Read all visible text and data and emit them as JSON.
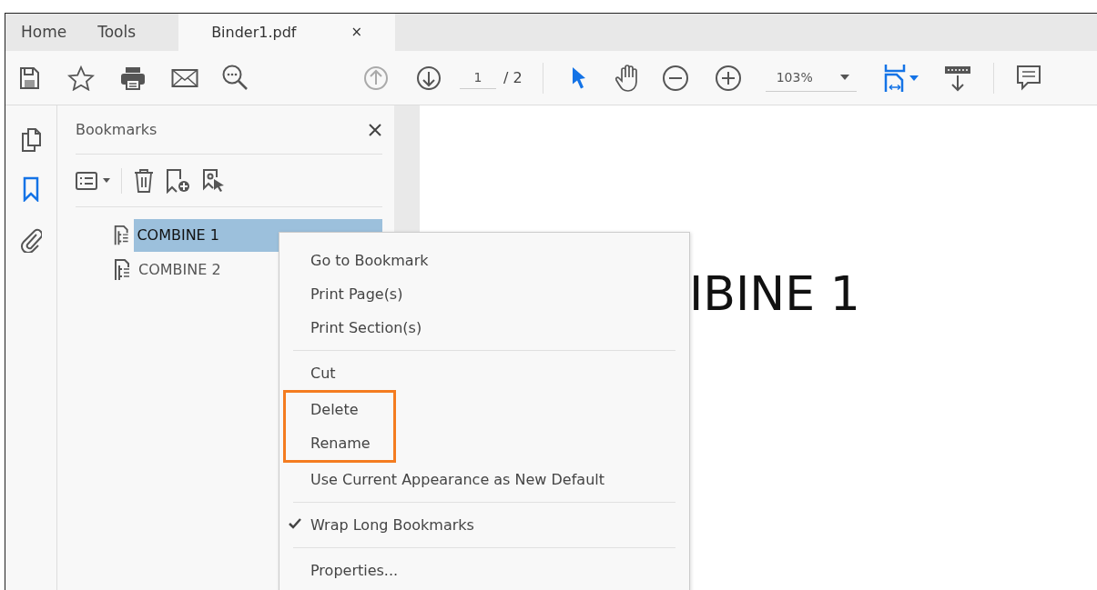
{
  "tabs": [
    {
      "label": "Home",
      "kind": "nav",
      "selected": false
    },
    {
      "label": "Tools",
      "kind": "nav",
      "selected": false
    },
    {
      "label": "Binder1.pdf",
      "kind": "document",
      "selected": true,
      "close": "×"
    }
  ],
  "toolbar": {
    "previous_disabled": true,
    "page_current": "1",
    "page_total": "/ 2",
    "zoom": "103%",
    "tools": [
      {
        "kind": "select",
        "selected": true
      },
      {
        "kind": "hand",
        "selected": false
      }
    ]
  },
  "left_rail": [
    {
      "kind": "pages",
      "selected": false
    },
    {
      "kind": "bookmarks",
      "selected": true
    },
    {
      "kind": "attachments",
      "selected": false
    }
  ],
  "bookmarks_panel": {
    "title": "Bookmarks",
    "items": [
      {
        "label": "COMBINE 1",
        "selected": true
      },
      {
        "label": "COMBINE 2",
        "selected": false
      }
    ]
  },
  "document": {
    "heading": "IBINE 1"
  },
  "context_menu": [
    {
      "kind": "item",
      "label": "Go to Bookmark",
      "checked": false,
      "highlighted": false
    },
    {
      "kind": "item",
      "label": "Print Page(s)",
      "checked": false,
      "highlighted": false
    },
    {
      "kind": "item",
      "label": "Print Section(s)",
      "checked": false,
      "highlighted": false
    },
    {
      "kind": "separator"
    },
    {
      "kind": "item",
      "label": "Cut",
      "checked": false,
      "highlighted": false
    },
    {
      "kind": "item",
      "label": "Delete",
      "checked": false,
      "highlighted": true
    },
    {
      "kind": "item",
      "label": "Rename",
      "checked": false,
      "highlighted": true
    },
    {
      "kind": "item",
      "label": "Use Current Appearance as New Default",
      "checked": false,
      "highlighted": false
    },
    {
      "kind": "separator"
    },
    {
      "kind": "item",
      "label": "Wrap Long Bookmarks",
      "checked": true,
      "highlighted": false
    },
    {
      "kind": "separator"
    },
    {
      "kind": "item",
      "label": "Properties...",
      "checked": false,
      "highlighted": false
    }
  ]
}
